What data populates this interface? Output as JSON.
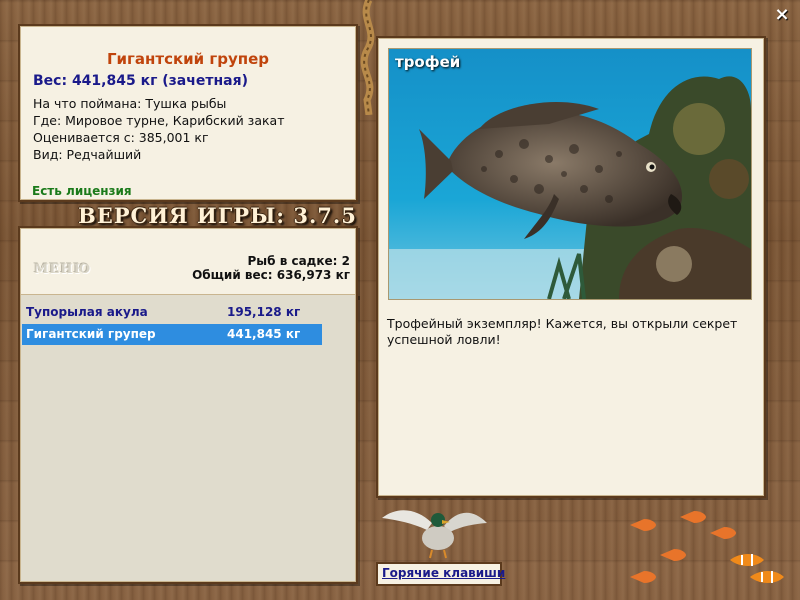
{
  "close_icon": "×",
  "catch": {
    "title": "Гигантский групер",
    "weight": "Вес: 441,845 кг (зачетная)",
    "bait": "На что поймана: Тушка рыбы",
    "location": "Где: Мировое турне, Карибский закат",
    "value": "Оценивается с: 385,001 кг",
    "rarity": "Вид: Редчайший",
    "license": "Есть лицензия"
  },
  "version": "ВЕРСИЯ ИГРЫ: 3.7.5",
  "menu_label": "МЕНЮ",
  "cage": {
    "count": "Рыб в садке: 2",
    "total": "Общий вес: 636,973 кг"
  },
  "fish_list": [
    {
      "name": "Тупорылая акула",
      "weight": "195,128 кг"
    },
    {
      "name": "Гигантский групер",
      "weight": "441,845 кг"
    }
  ],
  "selected_index": 1,
  "trophy": {
    "label": "трофей",
    "caption": "Трофейный экземпляр! Кажется, вы открыли секрет успешной ловли!"
  },
  "hotkeys_label": "Горячие клавиши"
}
